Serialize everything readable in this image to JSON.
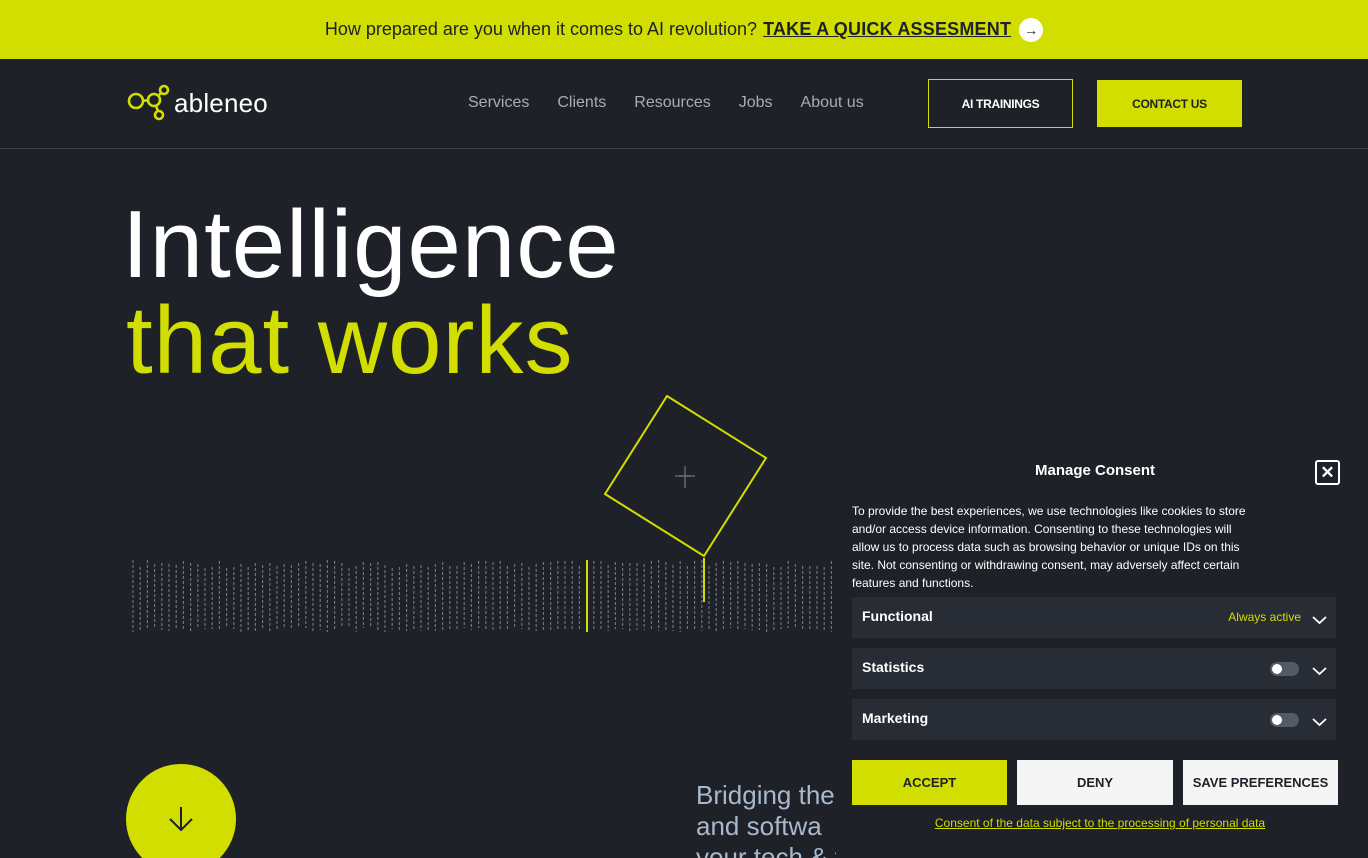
{
  "banner": {
    "text": "How prepared are you when it comes to AI revolution?",
    "link": "TAKE A QUICK ASSESMENT",
    "arrow_icon": "arrow-right-icon"
  },
  "nav": {
    "logo": "ableneo",
    "links": [
      "Services",
      "Clients",
      "Resources",
      "Jobs",
      "About us"
    ],
    "ai_trainings": "AI TRAININGS",
    "contact": "CONTACT US"
  },
  "hero": {
    "line1": "Intelligence",
    "line2": "that works",
    "intro_line1": "Bridging the",
    "intro_line2": "and softwa",
    "intro_line3": "your tech & transformation partner"
  },
  "colors": {
    "accent": "#d2de00",
    "background": "#1e2127",
    "panel": "#282c35"
  },
  "consent": {
    "title": "Manage Consent",
    "text": "To provide the best experiences, we use technologies like cookies to store and/or access device information. Consenting to these technologies will allow us to process data such as browsing behavior or unique IDs on this site. Not consenting or withdrawing consent, may adversely affect certain features and functions.",
    "categories": [
      {
        "name": "Functional",
        "status": "Always active"
      },
      {
        "name": "Statistics",
        "enabled": false
      },
      {
        "name": "Marketing",
        "enabled": false
      }
    ],
    "accept": "ACCEPT",
    "deny": "DENY",
    "save": "SAVE PREFERENCES",
    "link": "Consent of the data subject to the processing of personal data"
  }
}
